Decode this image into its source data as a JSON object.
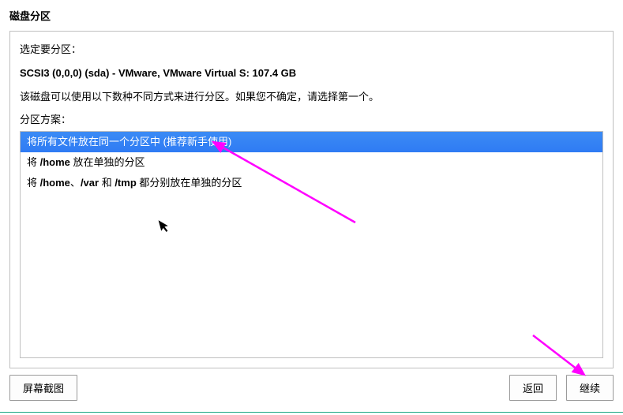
{
  "title": "磁盘分区",
  "intro": "选定要分区：",
  "disk": "SCSI3 (0,0,0) (sda) - VMware, VMware Virtual S: 107.4 GB",
  "desc": "该磁盘可以使用以下数种不同方式来进行分区。如果您不确定，请选择第一个。",
  "scheme_label": "分区方案：",
  "options": {
    "opt1": "将所有文件放在同一个分区中 (推荐新手使用)",
    "opt2_pre": "将 ",
    "opt2_home": "/home",
    "opt2_post": " 放在单独的分区",
    "opt3_pre": "将 ",
    "opt3_home": "/home",
    "opt3_sep1": "、",
    "opt3_var": "/var",
    "opt3_sep2": " 和 ",
    "opt3_tmp": "/tmp",
    "opt3_post": " 都分别放在单独的分区"
  },
  "buttons": {
    "screenshot": "屏幕截图",
    "back": "返回",
    "continue": "继续"
  }
}
